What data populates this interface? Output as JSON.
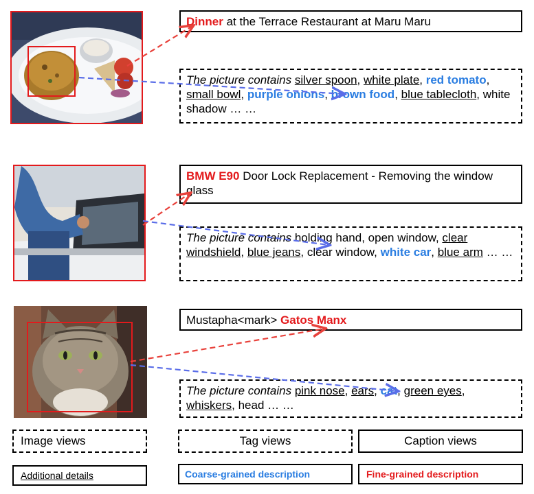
{
  "rows": [
    {
      "image_icon": "food-plate-photo",
      "fine": {
        "highlight": "Dinner",
        "rest": " at the Terrace Restaurant at Maru Maru"
      },
      "coarse": {
        "prefix": "The picture contains",
        "t1": "silver spoon",
        "t2": "white plate",
        "t3": "red tomato",
        "t4": "small bowl",
        "t5": "purple onions",
        "t6": "brown food",
        "t7": "blue tablecloth",
        "t8": "white shadow",
        "ellipsis": "… …"
      }
    },
    {
      "image_icon": "car-door-photo",
      "fine": {
        "highlight": "BMW E90",
        "rest": " Door Lock Replacement - Removing the window glass"
      },
      "coarse": {
        "prefix": "The picture contains",
        "t1": "holding hand",
        "t2": "open window",
        "t3": "clear windshield",
        "t4": "blue jeans",
        "t5": "clear window",
        "t6": "white car",
        "t7": "blue arm",
        "ellipsis": "… …"
      }
    },
    {
      "image_icon": "cat-photo",
      "fine": {
        "prefix": "Mustapha<mark> ",
        "highlight": "Gatos Manx"
      },
      "coarse": {
        "prefix": "The picture contains",
        "t1": "pink nose",
        "t2": "ears",
        "t3": "cat",
        "t4": "green eyes",
        "t5": "whiskers",
        "t6": "head",
        "ellipsis": "… …"
      }
    }
  ],
  "legend": {
    "image_views": "Image views",
    "tag_views": "Tag views",
    "caption_views": "Caption views",
    "additional_details": "Additional details",
    "coarse_grained": "Coarse-grained description",
    "fine_grained": "Fine-grained description"
  },
  "colors": {
    "fine": "#e31a1c",
    "coarse": "#2a7de1",
    "arrow_red": "#e8413b",
    "arrow_blue": "#5a6de8"
  }
}
